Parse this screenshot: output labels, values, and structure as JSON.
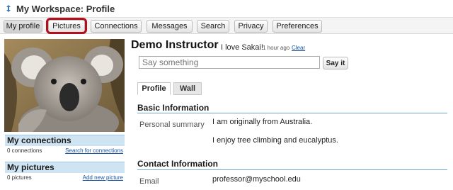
{
  "window": {
    "title": "My Workspace: Profile"
  },
  "toolbar": {
    "buttons": [
      {
        "label": "My profile",
        "active": true
      },
      {
        "label": "Pictures",
        "active": false
      },
      {
        "label": "Connections",
        "active": false
      },
      {
        "label": "Messages",
        "active": false
      },
      {
        "label": "Search",
        "active": false
      },
      {
        "label": "Privacy",
        "active": false
      },
      {
        "label": "Preferences",
        "active": false
      }
    ],
    "highlight_color": "#b3101b"
  },
  "left": {
    "connections": {
      "title": "My connections",
      "count": "0 connections",
      "link": "Search for connections"
    },
    "pictures": {
      "title": "My pictures",
      "count": "0 pictures",
      "link": "Add new picture"
    }
  },
  "profile": {
    "name": "Demo Instructor",
    "status": "I love Sakai!",
    "status_time": "1 hour ago",
    "status_clear": "Clear",
    "say_placeholder": "Say something",
    "say_button": "Say it",
    "tabs": [
      "Profile",
      "Wall"
    ]
  },
  "basic_info": {
    "title": "Basic Information",
    "personal_summary_label": "Personal summary",
    "lines": [
      "I am originally from Australia.",
      "I enjoy tree climbing and eucalyptus."
    ]
  },
  "contact_info": {
    "title": "Contact Information",
    "email_label": "Email",
    "email": "professor@myschool.edu"
  },
  "colors": {
    "accent": "#6aa6d1",
    "panel_bg": "#cfe4f3",
    "link": "#1a55a6"
  }
}
